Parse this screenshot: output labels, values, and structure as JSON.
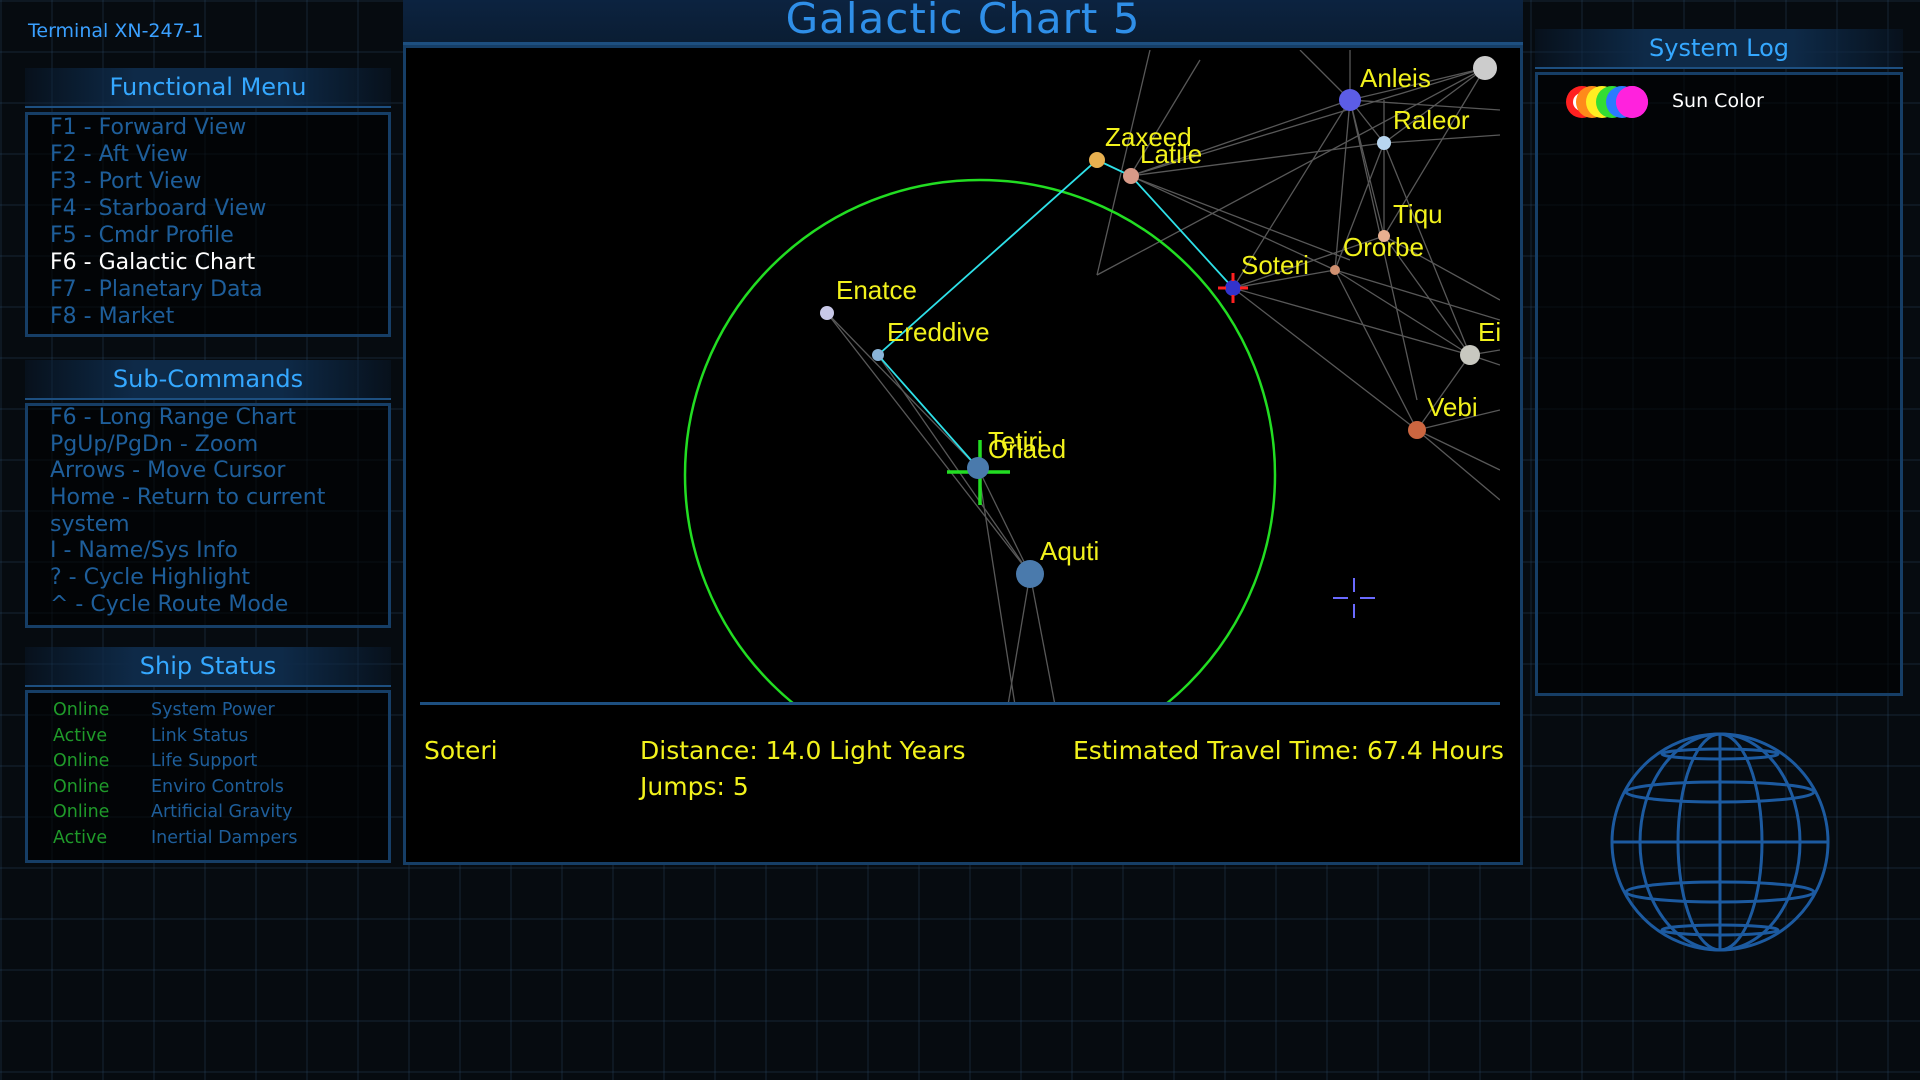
{
  "terminal": "Terminal XN-247-1",
  "functional_menu": {
    "title": "Functional Menu",
    "items": [
      {
        "key": "F1",
        "label": "F1  - Forward View",
        "active": false
      },
      {
        "key": "F2",
        "label": "F2  - Aft View",
        "active": false
      },
      {
        "key": "F3",
        "label": "F3  - Port View",
        "active": false
      },
      {
        "key": "F4",
        "label": "F4  - Starboard View",
        "active": false
      },
      {
        "key": "F5",
        "label": "F5  - Cmdr Profile",
        "active": false
      },
      {
        "key": "F6",
        "label": "F6  - Galactic Chart",
        "active": true
      },
      {
        "key": "F7",
        "label": "F7  - Planetary Data",
        "active": false
      },
      {
        "key": "F8",
        "label": "F8  - Market",
        "active": false
      }
    ]
  },
  "sub_commands": {
    "title": "Sub-Commands",
    "items": [
      "F6  - Long Range Chart",
      "PgUp/PgDn - Zoom",
      "Arrows - Move Cursor",
      "Home - Return to current",
      "system",
      "I  - Name/Sys Info",
      "? - Cycle Highlight",
      "^ - Cycle Route Mode"
    ]
  },
  "ship_status": {
    "title": "Ship Status",
    "items": [
      {
        "state": "Online",
        "system": "System Power"
      },
      {
        "state": "Active",
        "system": "Link Status"
      },
      {
        "state": "Online",
        "system": "Life Support"
      },
      {
        "state": "Online",
        "system": "Enviro Controls"
      },
      {
        "state": "Online",
        "system": "Artificial Gravity"
      },
      {
        "state": "Active",
        "system": "Inertial Dampers"
      }
    ]
  },
  "chart": {
    "title": "Galactic Chart 5",
    "systems": [
      {
        "name": "Anleis"
      },
      {
        "name": "Raleor"
      },
      {
        "name": "Zaxeed"
      },
      {
        "name": "Latile"
      },
      {
        "name": "Tiqu"
      },
      {
        "name": "Ororbe"
      },
      {
        "name": "Soteri"
      },
      {
        "name": "Enatce"
      },
      {
        "name": "Ereddive"
      },
      {
        "name": "Tetiri"
      },
      {
        "name": "Orlaed"
      },
      {
        "name": "Aquti"
      },
      {
        "name": "Vebi"
      },
      {
        "name": "Ei"
      }
    ],
    "colors": {
      "route": "#2ee0e8",
      "range_circle": "#22dd22",
      "label": "#f2f21c",
      "links": "#5a5a5a"
    }
  },
  "route_info": {
    "destination": "Soteri",
    "distance": "Distance: 14.0 Light Years",
    "jumps": "Jumps: 5",
    "travel_time": "Estimated Travel Time: 67.4 Hours"
  },
  "system_log": {
    "title": "System Log",
    "sun_color_label": "Sun Color",
    "sun_colors": [
      "#ff2020",
      "#ff8a1a",
      "#ffee22",
      "#33dd33",
      "#2a7bff",
      "#ff22dd"
    ]
  },
  "globe_icon": "wireframe-globe-icon"
}
